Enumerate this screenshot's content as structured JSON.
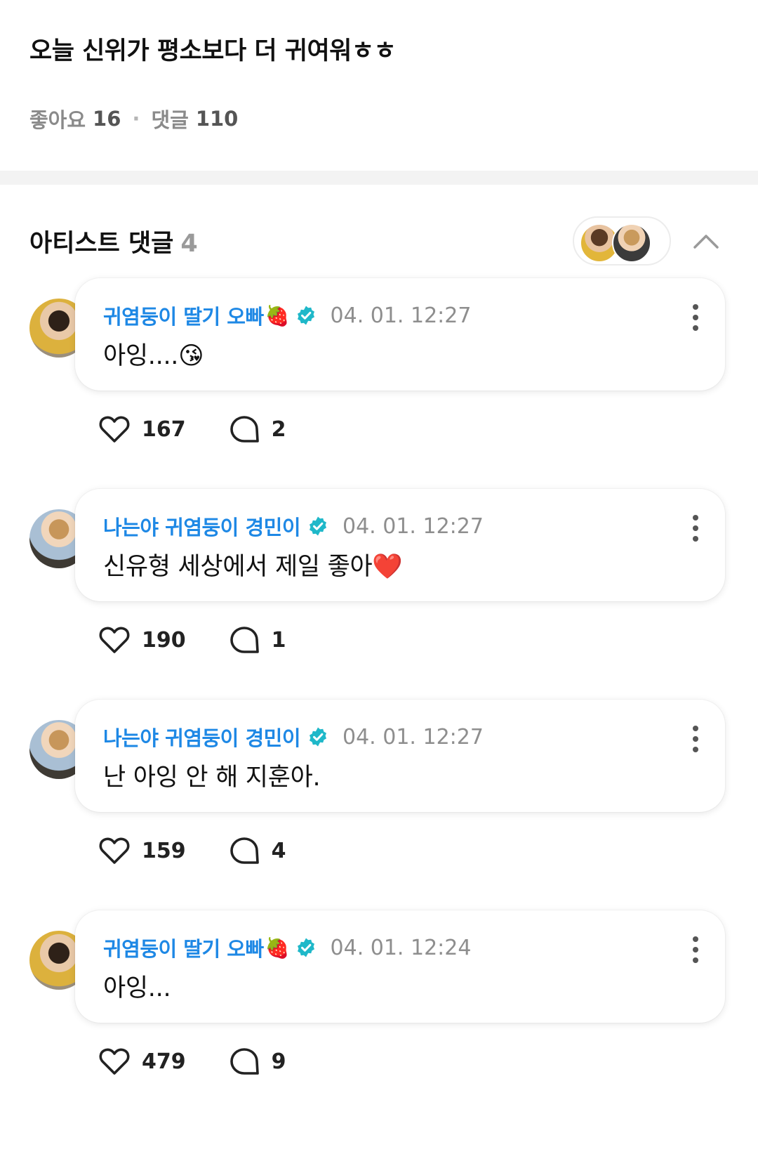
{
  "post": {
    "title": "오늘 신위가 평소보다 더 귀여워ㅎㅎ",
    "likes_label": "좋아요",
    "likes_count": "16",
    "separator": "·",
    "comments_label": "댓글",
    "comments_count": "110"
  },
  "artist_section": {
    "title": "아티스트 댓글",
    "count": "4",
    "collapse_icon": "chevron-up-icon"
  },
  "icons": {
    "verified": "verified-badge-icon",
    "more": "more-vertical-icon",
    "like": "heart-icon",
    "reply": "speech-bubble-icon"
  },
  "colors": {
    "author_name": "#1e88e5",
    "verified_badge": "#1fb8c9",
    "section_band": "#f3f3f3"
  },
  "comments": [
    {
      "author": "귀염둥이 딸기 오빠",
      "author_emoji": "🍓",
      "time": "04. 01. 12:27",
      "text": "아잉....😘",
      "likes": "167",
      "replies": "2"
    },
    {
      "author": "나는야 귀염둥이 경민이",
      "author_emoji": "",
      "time": "04. 01. 12:27",
      "text": "신유형 세상에서 제일 좋아❤️",
      "likes": "190",
      "replies": "1"
    },
    {
      "author": "나는야 귀염둥이 경민이",
      "author_emoji": "",
      "time": "04. 01. 12:27",
      "text": "난 아잉 안 해 지훈아.",
      "likes": "159",
      "replies": "4"
    },
    {
      "author": "귀염둥이 딸기 오빠",
      "author_emoji": "🍓",
      "time": "04. 01. 12:24",
      "text": "아잉...",
      "likes": "479",
      "replies": "9"
    }
  ]
}
